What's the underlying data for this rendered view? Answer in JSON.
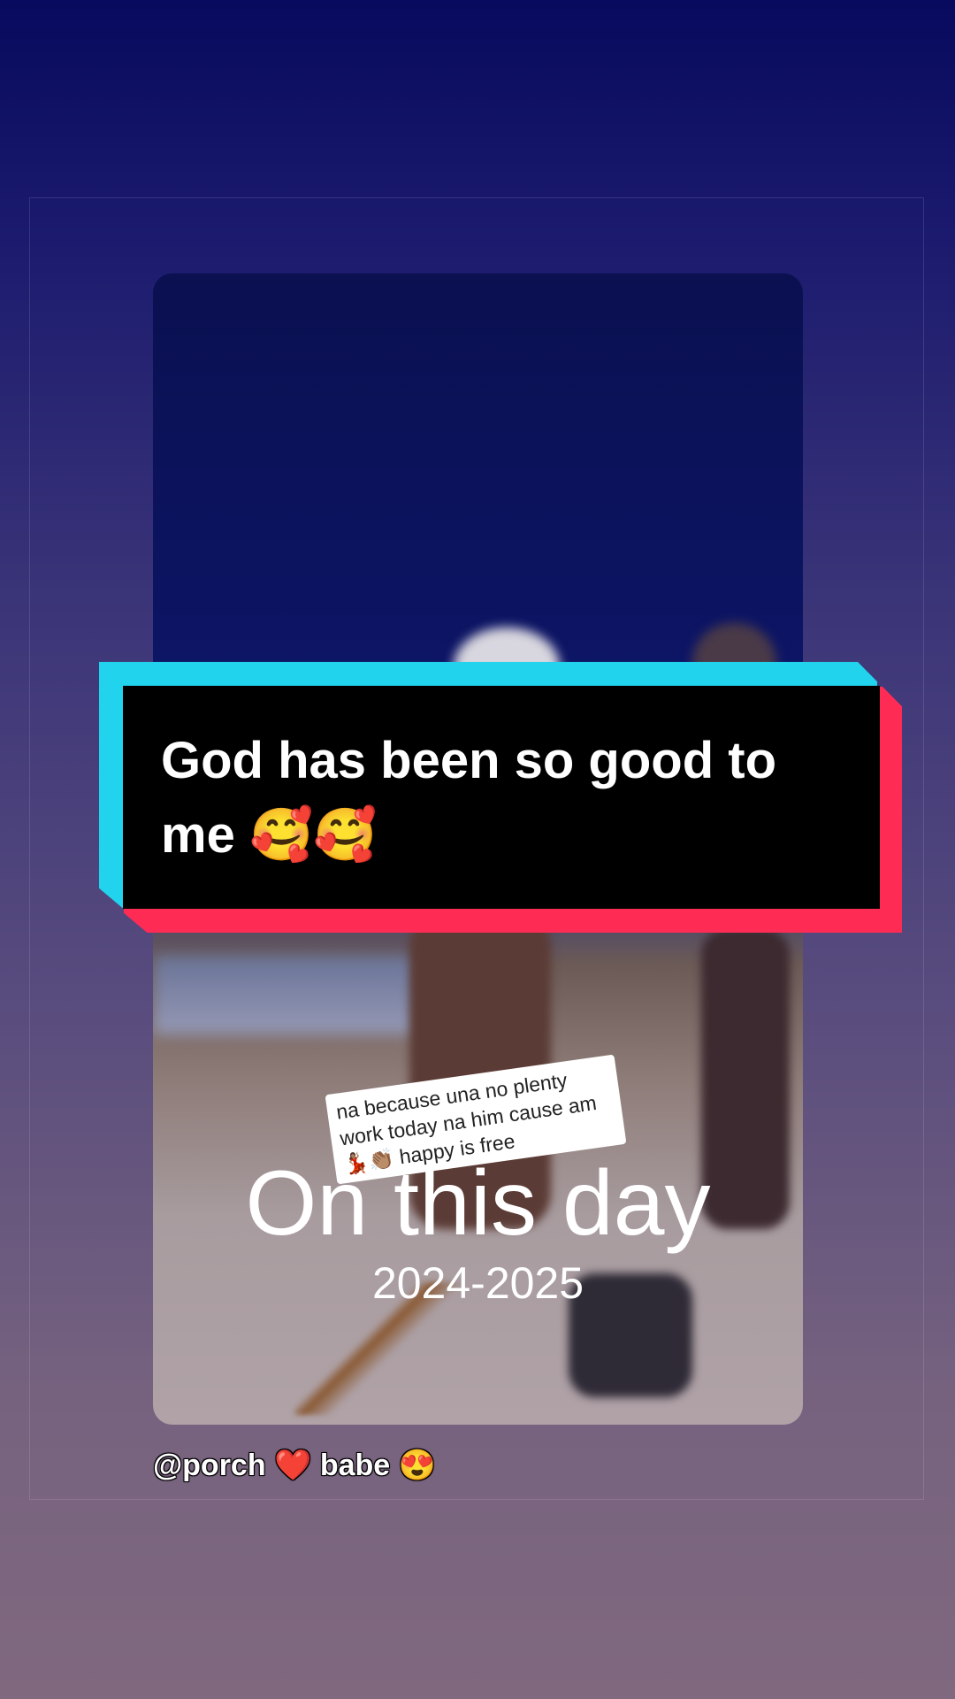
{
  "banner": {
    "text": "God has been so good to me 🥰🥰"
  },
  "memory": {
    "title": "On this day",
    "years": "2024-2025"
  },
  "video": {
    "sticker_text": "na because una no plenty work today na him cause am 💃🏽👏🏽 happy is free"
  },
  "caption": {
    "text": "@porch ❤️ babe 😍"
  },
  "colors": {
    "banner_cyan": "#22d3ee",
    "banner_red": "#fe2c55",
    "banner_bg": "#000000"
  }
}
